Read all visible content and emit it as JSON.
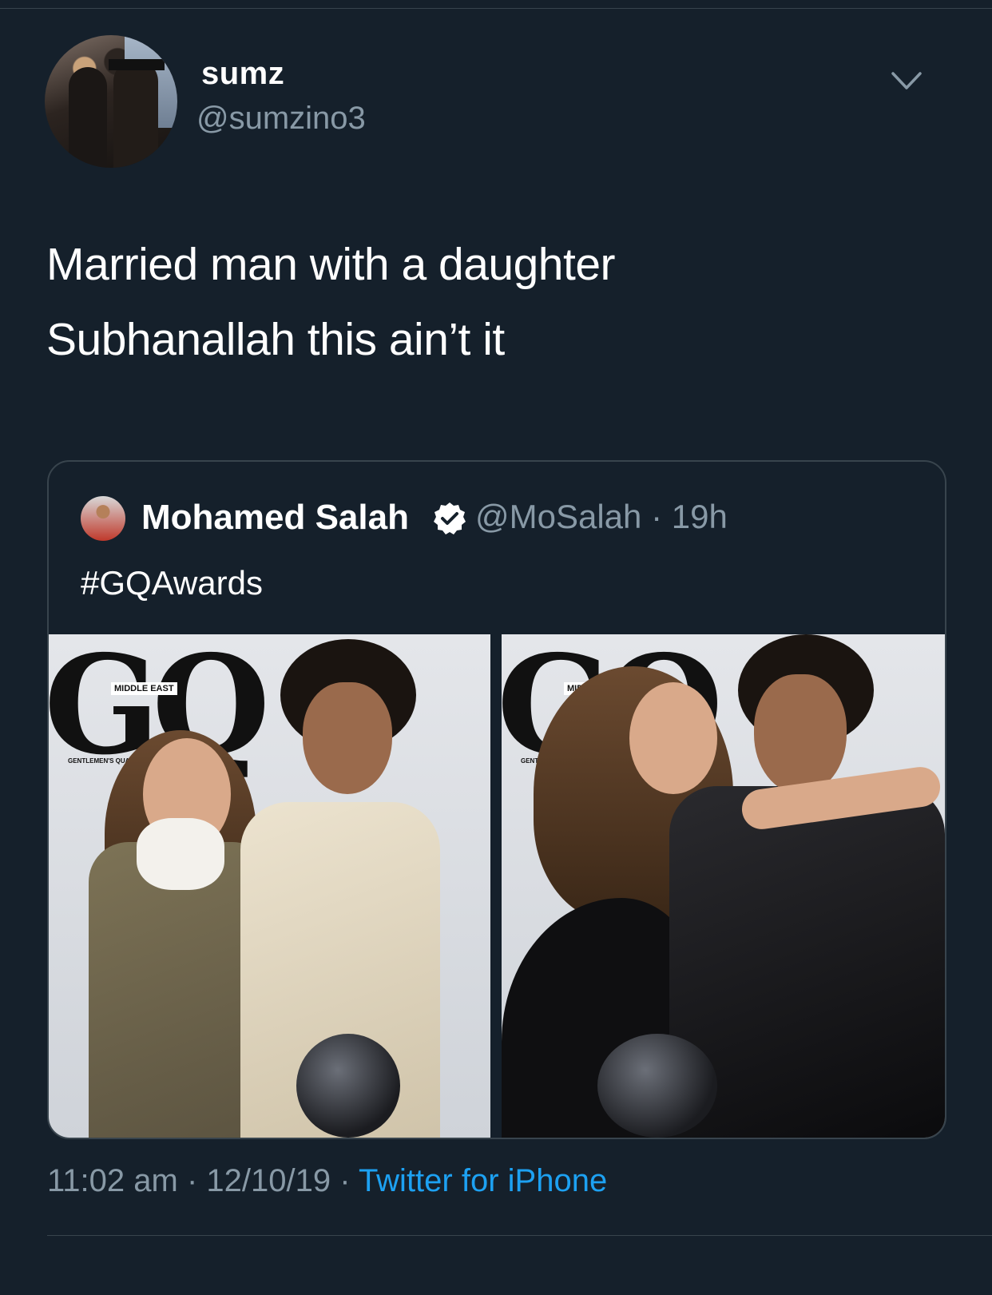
{
  "tweet": {
    "display_name": "sumz",
    "handle": "@sumzino3",
    "text_line1": "Married man with a daughter",
    "text_line2": "Subhanallah this ain’t it",
    "time": "11:02 am",
    "separator": "·",
    "date": "12/10/19",
    "source": "Twitter for iPhone"
  },
  "quoted": {
    "display_name": "Mohamed Salah",
    "handle": "@MoSalah",
    "separator": "·",
    "age": "19h",
    "text": "#GQAwards",
    "photos": [
      {
        "masthead": "GQ",
        "edition": "MIDDLE EAST",
        "tagline": "GENTLEMEN'S QUA"
      },
      {
        "masthead": "GQ",
        "edition": "MIDDLE EAST",
        "tagline": "GENTLEMEN'S QUARTE"
      }
    ]
  },
  "icons": {
    "menu": "chevron-down-icon",
    "verified": "verified-badge-icon"
  },
  "colors": {
    "background": "#15202b",
    "secondary_text": "#8899a6",
    "link": "#1da1f2",
    "border": "#38444d"
  }
}
